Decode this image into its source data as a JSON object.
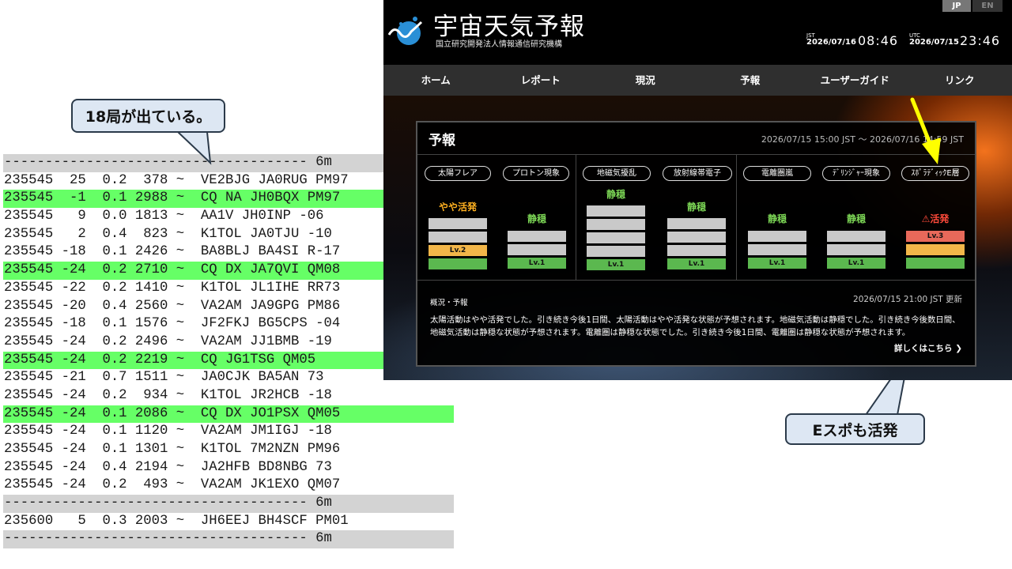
{
  "log": {
    "rows": [
      {
        "kind": "sep",
        "text": "------------------------------------- 6m"
      },
      {
        "kind": "row",
        "text": "235545  25  0.2  378 ~  VE2BJG JA0RUG PM97"
      },
      {
        "kind": "cq",
        "text": "235545  -1  0.1 2988 ~  CQ NA JH0BQX PM97"
      },
      {
        "kind": "row",
        "text": "235545   9  0.0 1813 ~  AA1V JH0INP -06"
      },
      {
        "kind": "row",
        "text": "235545   2  0.4  823 ~  K1TOL JA0TJU -10"
      },
      {
        "kind": "row",
        "text": "235545 -18  0.1 2426 ~  BA8BLJ BA4SI R-17"
      },
      {
        "kind": "cq",
        "text": "235545 -24  0.2 2710 ~  CQ DX JA7QVI QM08"
      },
      {
        "kind": "row",
        "text": "235545 -22  0.2 1410 ~  K1TOL JL1IHE RR73"
      },
      {
        "kind": "row",
        "text": "235545 -20  0.4 2560 ~  VA2AM JA9GPG PM86"
      },
      {
        "kind": "row",
        "text": "235545 -18  0.1 1576 ~  JF2FKJ BG5CPS -04"
      },
      {
        "kind": "row",
        "text": "235545 -24  0.2 2496 ~  VA2AM JJ1BMB -19"
      },
      {
        "kind": "cq",
        "text": "235545 -24  0.2 2219 ~  CQ JG1TSG QM05"
      },
      {
        "kind": "row",
        "text": "235545 -21  0.7 1511 ~  JA0CJK BA5AN 73"
      },
      {
        "kind": "row",
        "text": "235545 -24  0.2  934 ~  K1TOL JR2HCB -18"
      },
      {
        "kind": "cq",
        "text": "235545 -24  0.1 2086 ~  CQ DX JO1PSX QM05"
      },
      {
        "kind": "row",
        "text": "235545 -24  0.1 1120 ~  VA2AM JM1IGJ -18"
      },
      {
        "kind": "row",
        "text": "235545 -24  0.1 1301 ~  K1TOL 7M2NZN PM96"
      },
      {
        "kind": "row",
        "text": "235545 -24  0.4 2194 ~  JA2HFB BD8NBG 73"
      },
      {
        "kind": "row",
        "text": "235545 -24  0.2  493 ~  VA2AM JK1EXO QM07"
      },
      {
        "kind": "sep",
        "text": "------------------------------------- 6m"
      },
      {
        "kind": "row",
        "text": "235600   5  0.3 2003 ~  JH6EEJ BH4SCF PM01"
      },
      {
        "kind": "sep",
        "text": "------------------------------------- 6m"
      }
    ]
  },
  "callouts": {
    "stations": "18局が出ている。",
    "esporadic": "Eスポも活発"
  },
  "site": {
    "title": "宇宙天気予報",
    "subtitle": "国立研究開発法人情報通信研究機構",
    "lang_jp": "JP",
    "lang_en": "EN",
    "jst_label": "JST",
    "jst_date": "2026/07/16",
    "jst_time": "08:46",
    "utc_label": "UTC",
    "utc_date": "2026/07/15",
    "utc_time": "23:46",
    "nav": [
      "ホーム",
      "レポート",
      "現況",
      "予報",
      "ユーザーガイド",
      "リンク"
    ],
    "forecast": {
      "title": "予報",
      "range": "2026/07/15 15:00 JST 〜 2026/07/16 14:59 JST",
      "categories": [
        {
          "label": "太陽フレア",
          "status": "やや活発",
          "level": "Lv.2"
        },
        {
          "label": "プロトン現象",
          "status": "静穏",
          "level": "Lv.1"
        },
        {
          "label": "地磁気擾乱",
          "status": "静穏",
          "level": "Lv.1"
        },
        {
          "label": "放射線帯電子",
          "status": "静穏",
          "level": "Lv.1"
        },
        {
          "label": "電離圏嵐",
          "status": "静穏",
          "level": "Lv.1"
        },
        {
          "label": "ﾃﾞﾘﾝｼﾞｬｰ現象",
          "status": "静穏",
          "level": "Lv.1"
        },
        {
          "label": "ｽﾎﾟﾗﾃﾞｨｯｸE層",
          "status": "活発",
          "level": "Lv.3"
        }
      ],
      "summary_heading": "概況・予報",
      "summary_updated": "2026/07/15 21:00 JST 更新",
      "summary_text": "太陽活動はやや活発でした。引き続き今後1日間、太陽活動はやや活発な状態が予想されます。地磁気活動は静穏でした。引き続き今後数日間、地磁気活動は静穏な状態が予想されます。電離圏は静穏な状態でした。引き続き今後1日間、電離圏は静穏な状態が予想されます。",
      "more_link": "詳しくはこちら ❯"
    }
  },
  "colors": {
    "cq_highlight": "#66ff66",
    "separator": "#d3d3d3",
    "level1": "#5bb84f",
    "level2": "#f2b649",
    "level3": "#e8695a",
    "status_green": "#7ed957",
    "status_orange": "#ffb020",
    "status_red": "#ff4a3a",
    "arrow": "#ffff00"
  }
}
